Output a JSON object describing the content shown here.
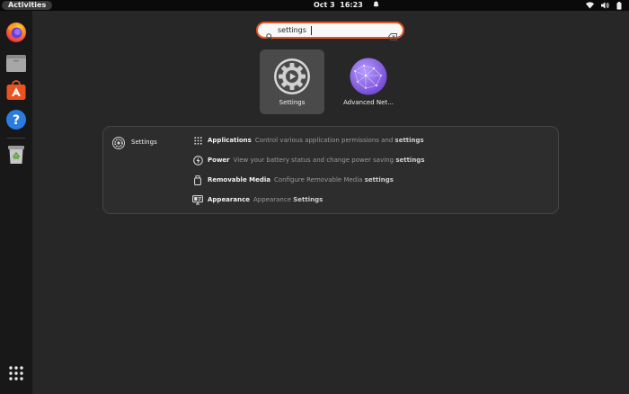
{
  "topbar": {
    "activities_label": "Activities",
    "date": "Oct 3",
    "time": "16:23",
    "icons": [
      "alarm-bell-icon",
      "wifi-icon",
      "volume-icon",
      "battery-icon"
    ]
  },
  "dock": {
    "items": [
      "firefox-icon",
      "files-icon",
      "app-center-icon",
      "help-icon",
      "trash-icon"
    ],
    "show_apps_icon": "app-grid-icon"
  },
  "search": {
    "value": "settings",
    "icon": "search-icon",
    "clear_icon": "clear-icon"
  },
  "apps": [
    {
      "label": "Settings",
      "icon": "settings-gear-icon",
      "selected": true
    },
    {
      "label": "Advanced Net...",
      "icon": "network-globe-icon",
      "selected": false
    }
  ],
  "provider": {
    "name": "Settings",
    "icon": "settings-icon",
    "results": [
      {
        "title": "Applications",
        "desc_pre": "Control various application permissions and",
        "desc_hl": "settings",
        "icon": "app-grid-icon"
      },
      {
        "title": "Power",
        "desc_pre": "View your battery status and change power saving",
        "desc_hl": "settings",
        "icon": "power-icon"
      },
      {
        "title": "Removable Media",
        "desc_pre": "Configure Removable Media",
        "desc_hl": "settings",
        "icon": "usb-drive-icon"
      },
      {
        "title": "Appearance",
        "desc_pre": "Appearance",
        "desc_hl": "Settings",
        "icon": "display-icon"
      }
    ]
  },
  "colors": {
    "accent": "#e95420",
    "background": "#272727",
    "dock": "#181818",
    "topbar": "#0a0a0a"
  }
}
